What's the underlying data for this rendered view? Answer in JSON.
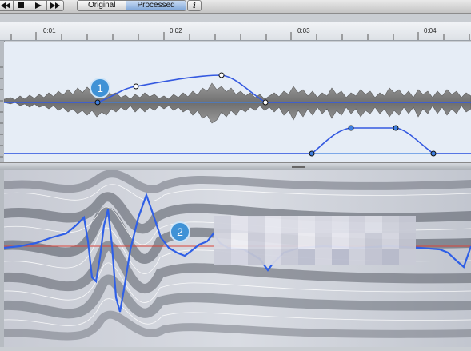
{
  "toolbar": {
    "transport": [
      {
        "name": "rewind-icon",
        "glyph": "◀◀"
      },
      {
        "name": "stop-icon",
        "glyph": "■"
      },
      {
        "name": "play-icon",
        "glyph": "▶"
      },
      {
        "name": "fast-forward-icon",
        "glyph": "▶▶"
      }
    ],
    "mode_original": "Original",
    "mode_processed": "Processed",
    "mode_selected": "Processed",
    "info_label": "i"
  },
  "ruler": {
    "ticks": [
      "0:01",
      "0:02",
      "0:03",
      "0:04"
    ]
  },
  "markers": {
    "one": "1",
    "two": "2"
  },
  "colors": {
    "accent": "#3f7fe0",
    "envelope_bg": "#e6edf6",
    "waveform": "#808080",
    "pitch_line": "#2f5fe6",
    "reference_line": "#d8443a",
    "marker": "#3f92d6"
  }
}
